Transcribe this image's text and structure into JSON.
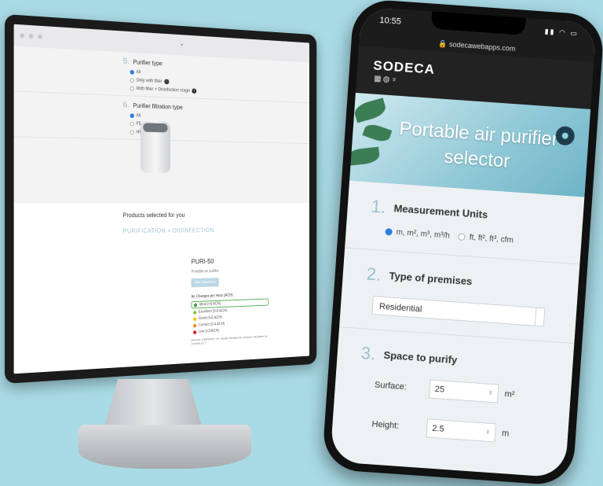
{
  "desktop": {
    "sections": [
      {
        "num": "5.",
        "title": "Purifier type",
        "options": [
          {
            "label": "All",
            "selected": true,
            "info": false
          },
          {
            "label": "Only with filter",
            "selected": false,
            "info": true
          },
          {
            "label": "With filter + Disinfection stage",
            "selected": false,
            "info": true
          }
        ]
      },
      {
        "num": "6.",
        "title": "Purifier filtration type",
        "options": [
          {
            "label": "All",
            "selected": true,
            "info": false
          },
          {
            "label": "F5",
            "selected": false,
            "info": true
          },
          {
            "label": "HEPA H14",
            "selected": false,
            "info": true
          }
        ]
      }
    ],
    "products_title": "Products selected for you",
    "category": "PURIFICATION + DISINFECTION",
    "product": {
      "name": "PURI-50",
      "subtitle": "Portable air purifier",
      "sheet_button": "See datasheet",
      "ach_title": "Air Changes per Hour (ACH)",
      "ach": [
        {
          "label": "Ideal (>6 ACH)",
          "color": "#3aa53a",
          "selected": true
        },
        {
          "label": "Excellent (5-6 ACH)",
          "color": "#8ac43f",
          "selected": false
        },
        {
          "label": "Good (4-5 ACH)",
          "color": "#f0c419",
          "selected": false
        },
        {
          "label": "Correct (3-4 ACH)",
          "color": "#f08a19",
          "selected": false
        },
        {
          "label": "Low (<3 ACH)",
          "color": "#d9242a",
          "selected": false
        }
      ],
      "source": "(Source: HARVARD T.H. Health Portable Air Cleaner Calculator for schools v1.7"
    }
  },
  "phone": {
    "time": "10:55",
    "url": "sodecawebapps.com",
    "logo": "SODECA",
    "hero_title": "Portable air purifier selector",
    "sections": {
      "units": {
        "num": "1.",
        "title": "Measurement Units",
        "opt1": "m, m², m³, m³/h",
        "opt2": "ft, ft², ft³, cfm"
      },
      "premises": {
        "num": "2.",
        "title": "Type of premises",
        "value": "Residential"
      },
      "space": {
        "num": "3.",
        "title": "Space to purify",
        "surface_label": "Surface:",
        "surface_value": "25",
        "surface_unit": "m²",
        "height_label": "Height:",
        "height_value": "2.5",
        "height_unit": "m"
      }
    }
  }
}
